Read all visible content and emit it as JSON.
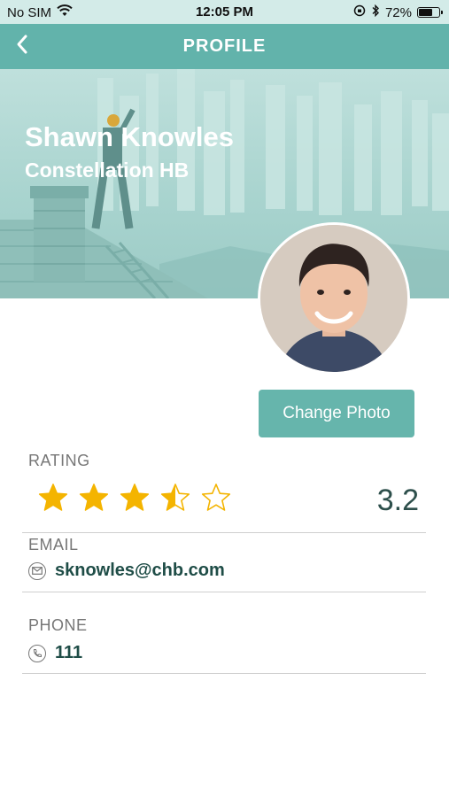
{
  "status_bar": {
    "carrier": "No SIM",
    "time": "12:05 PM",
    "battery_percent": "72%",
    "battery_level": 0.72
  },
  "nav": {
    "title": "PROFILE",
    "back_icon": "chevron-left-icon"
  },
  "profile": {
    "name": "Shawn Knowles",
    "company": "Constellation HB",
    "change_photo_label": "Change Photo"
  },
  "rating": {
    "label": "RATING",
    "value": "3.2",
    "stars": 3.5,
    "max_stars": 5,
    "star_color": "#f4b400"
  },
  "email": {
    "label": "EMAIL",
    "value": "sknowles@chb.com",
    "icon": "mail-icon"
  },
  "phone": {
    "label": "PHONE",
    "value": "111",
    "icon": "phone-icon"
  },
  "colors": {
    "header": "#62b3ab",
    "button": "#66b5ac",
    "status_bar": "#d3ebe8",
    "info_text": "#1f4d47"
  }
}
